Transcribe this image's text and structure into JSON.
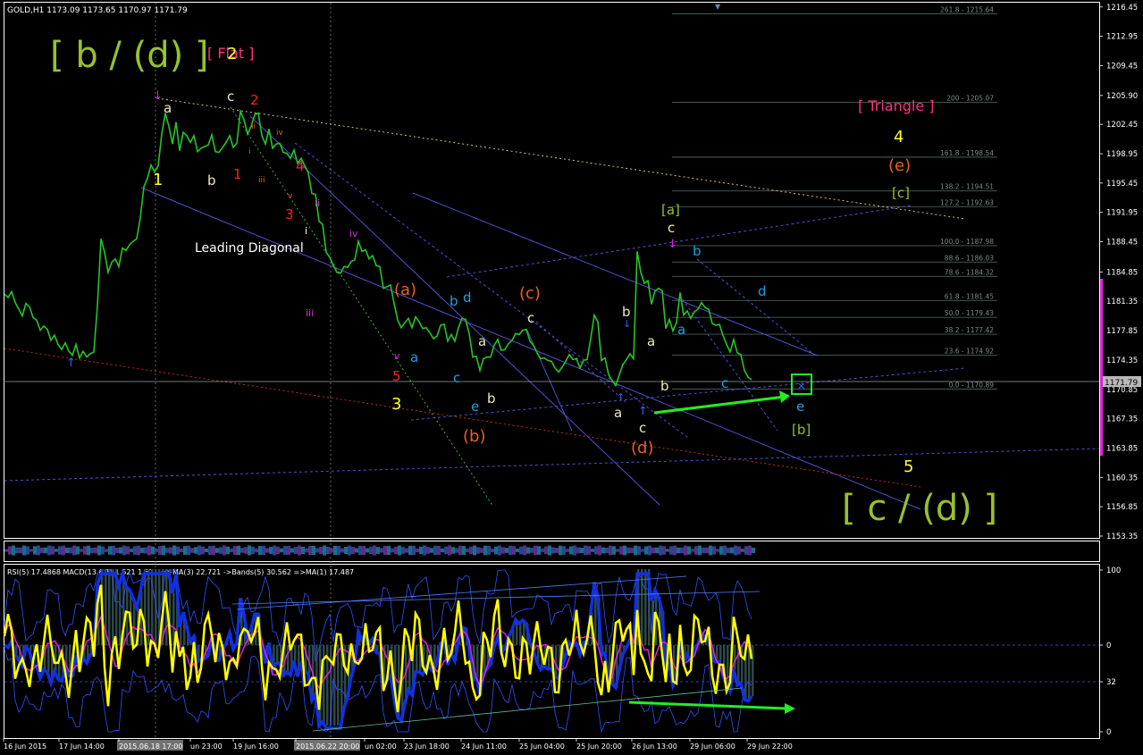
{
  "window": {
    "header": "GOLD,H1  1173.09 1173.65 1170.97 1171.79",
    "price_tag": "1171.79",
    "indicator_header": "RSI(5) 17.4868  MACD(13,6,1) 1.521 1.521  =>MA(3) 22.721  ->Bands(5) 30.562  =>MA(1) 17.487"
  },
  "colors": {
    "background": "#000000",
    "price_line": "#27c427",
    "rsi_line": "#ffff00",
    "ma_line": "#e020e0",
    "band_line": "#3050ff",
    "macd_hist": "#2e4848",
    "fib_line": "#4a6060",
    "green_arrow": "#22ee22"
  },
  "chart_data": [
    {
      "type": "line",
      "name": "GOLD H1 price",
      "ylim": [
        1153.35,
        1216.64
      ],
      "y_ticks": [
        "1216.45",
        "1212.95",
        "1209.45",
        "1205.90",
        "1202.45",
        "1198.95",
        "1195.45",
        "1191.95",
        "1188.45",
        "1184.85",
        "1181.35",
        "1177.85",
        "1174.35",
        "1170.85",
        "1167.35",
        "1163.85",
        "1160.35",
        "1156.85",
        "1153.35"
      ],
      "x_ticks": [
        "16 Jun 2015",
        "17 Jun 14:00",
        "2015.06.18 17:00",
        "un 23:00",
        "19 Jun 16:00",
        "2015.06.22 20:00",
        "un 02:00",
        "23 Jun 18:00",
        "24 Jun 11:00",
        "25 Jun 04:00",
        "25 Jun 20:00",
        "26 Jun 13:00",
        "29 Jun 06:00",
        "29 Jun 22:00"
      ],
      "x": [
        0,
        4,
        8,
        12,
        16,
        20,
        24,
        28,
        32,
        36,
        40,
        44,
        48,
        52,
        56,
        60,
        64,
        68,
        72,
        76,
        80,
        84,
        88,
        92,
        96,
        100,
        104,
        108,
        112,
        116,
        120,
        124,
        128,
        132,
        136,
        140,
        144,
        148,
        152,
        156,
        160,
        164,
        168,
        172,
        176,
        180,
        184,
        188,
        192,
        196,
        200,
        204,
        208,
        212,
        216,
        220,
        224,
        228,
        232,
        236,
        240,
        244,
        248,
        252,
        256,
        260,
        264,
        268,
        272,
        276,
        280,
        284,
        288,
        292,
        296,
        300,
        304,
        308,
        312,
        316,
        320,
        324,
        328,
        332,
        336,
        340,
        344,
        348,
        352,
        356,
        360,
        364,
        368,
        372,
        376,
        380,
        384,
        388,
        392,
        396,
        400,
        404,
        408,
        412,
        416,
        420,
        424,
        428,
        432,
        436,
        440,
        444,
        448,
        452,
        456,
        460,
        464,
        468,
        472,
        476,
        480,
        484,
        488,
        492,
        496,
        500,
        504,
        508,
        512,
        516,
        520,
        524,
        528,
        532,
        536,
        540,
        544,
        548,
        552,
        556,
        560,
        564,
        568,
        572,
        576,
        580,
        584,
        588,
        592,
        596,
        600,
        604,
        608,
        612,
        616,
        620,
        624,
        628,
        632,
        636,
        640,
        644,
        648,
        652,
        656,
        660,
        664,
        668,
        672,
        676,
        680,
        684,
        688,
        692,
        696,
        700,
        704,
        708,
        712,
        716,
        720,
        724,
        728,
        732,
        736,
        740,
        744,
        748,
        752,
        756,
        760,
        764,
        768,
        772,
        776,
        780,
        784,
        788,
        792,
        796,
        800,
        804,
        808,
        812,
        816,
        820,
        824,
        828,
        832,
        836,
        840,
        844,
        848,
        852,
        856,
        860,
        864,
        868,
        872,
        876,
        880,
        884,
        888,
        892,
        896,
        900,
        904
      ],
      "y": [
        1182.2,
        1181.8,
        1182.5,
        1181.2,
        1180.4,
        1179.6,
        1181.1,
        1180.7,
        1179.4,
        1179.1,
        1177.9,
        1178.4,
        1178.0,
        1176.7,
        1177.3,
        1176.2,
        1175.6,
        1176.4,
        1175.4,
        1174.9,
        1176.2,
        1174.6,
        1175.4,
        1174.7,
        1175.1,
        1175.3,
        1180.8,
        1188.8,
        1187.2,
        1184.8,
        1186.0,
        1186.4,
        1185.5,
        1187.7,
        1187.4,
        1188.1,
        1188.5,
        1188.8,
        1191.3,
        1195.0,
        1196.0,
        1197.6,
        1196.8,
        1197.5,
        1201.3,
        1203.8,
        1202.2,
        1200.1,
        1202.7,
        1199.3,
        1201.5,
        1201.1,
        1200.3,
        1201.1,
        1199.2,
        1199.6,
        1199.8,
        1200.0,
        1201.2,
        1199.2,
        1199.1,
        1199.7,
        1200.3,
        1201.1,
        1199.7,
        1200.2,
        1204.0,
        1203.0,
        1201.3,
        1202.2,
        1203.6,
        1203.8,
        1201.1,
        1200.1,
        1201.9,
        1199.6,
        1200.1,
        1200.2,
        1199.1,
        1199.0,
        1198.4,
        1199.4,
        1197.8,
        1198.4,
        1197.5,
        1196.7,
        1194.2,
        1194.1,
        1190.9,
        1190.5,
        1187.2,
        1186.6,
        1185.6,
        1184.8,
        1184.7,
        1185.5,
        1185.4,
        1186.1,
        1186.3,
        1188.5,
        1187.3,
        1187.5,
        1186.4,
        1186.8,
        1185.6,
        1185.5,
        1182.9,
        1183.1,
        1183.3,
        1181.1,
        1179.1,
        1178.2,
        1178.8,
        1179.3,
        1178.2,
        1179.5,
        1178.9,
        1178.1,
        1178.2,
        1177.6,
        1176.9,
        1177.2,
        1178.5,
        1178.6,
        1176.6,
        1177.4,
        1176.6,
        1178.2,
        1179.3,
        1179.2,
        1177.5,
        1174.7,
        1174.8,
        1173.1,
        1174.5,
        1174.7,
        1174.7,
        1176.1,
        1176.8,
        1175.5,
        1175.6,
        1176.3,
        1176.7,
        1177.5,
        1177.4,
        1177.9,
        1178.0,
        1176.6,
        1176.1,
        1175.2,
        1174.5,
        1174.6,
        1174.3,
        1174.2,
        1173.4,
        1172.9,
        1173.5,
        1174.2,
        1175.0,
        1174.4,
        1174.5,
        1173.4,
        1174.3,
        1174.4,
        1176.9,
        1179.7,
        1178.9,
        1174.3,
        1174.6,
        1172.6,
        1171.9,
        1171.3,
        1172.6,
        1173.8,
        1174.4,
        1175.1,
        1174.5,
        1187.3,
        1184.8,
        1183.5,
        1183.8,
        1181.0,
        1182.6,
        1182.9,
        1182.6,
        1178.1,
        1179.2,
        1177.8,
        1178.8,
        1182.4,
        1179.7,
        1180.2,
        1179.3,
        1180.1,
        1180.4,
        1181.2,
        1180.6,
        1180.4,
        1178.7,
        1178.5,
        1178.6,
        1177.3,
        1176.2,
        1175.3,
        1176.8,
        1175.2,
        1175.0,
        1173.1,
        1172.3,
        1172.0
      ]
    },
    {
      "type": "line",
      "name": "RSI(5)",
      "ylim": [
        0,
        100
      ],
      "y_ticks": [
        "100",
        "0",
        "32",
        "0"
      ]
    }
  ],
  "fib_levels": [
    {
      "label": "261.8 - 1215.64",
      "price": 1215.64
    },
    {
      "label": "200 - 1205.07",
      "price": 1205.07
    },
    {
      "label": "161.8 - 1198.54",
      "price": 1198.54
    },
    {
      "label": "138.2 - 1194.51",
      "price": 1194.51
    },
    {
      "label": "127.2 - 1192.63",
      "price": 1192.63
    },
    {
      "label": "100.0 - 1187.98",
      "price": 1187.98
    },
    {
      "label": "88.6 - 1186.03",
      "price": 1186.03
    },
    {
      "label": "78.6 - 1184.32",
      "price": 1184.32
    },
    {
      "label": "61.8 - 1181.45",
      "price": 1181.45
    },
    {
      "label": "50.0 - 1179.43",
      "price": 1179.43
    },
    {
      "label": "38.2 - 1177.42",
      "price": 1177.42
    },
    {
      "label": "23.6 - 1174.92",
      "price": 1174.92
    },
    {
      "label": "0.0 - 1170.89",
      "price": 1170.89
    }
  ],
  "annotations": {
    "b_d": "[ b / (d) ]",
    "flat": "[ Flat ]",
    "triangle": "[ Triangle ]",
    "c_d": "[ c / (d) ]",
    "leading_diagonal": "Leading Diagonal",
    "wave_a_box": "[a]",
    "wave_b_box": "[b]",
    "wave_c_box": "[c]",
    "paren_a": "(a)",
    "paren_b": "(b)",
    "paren_c": "(c)",
    "paren_d": "(d)",
    "paren_e": "(e)"
  }
}
